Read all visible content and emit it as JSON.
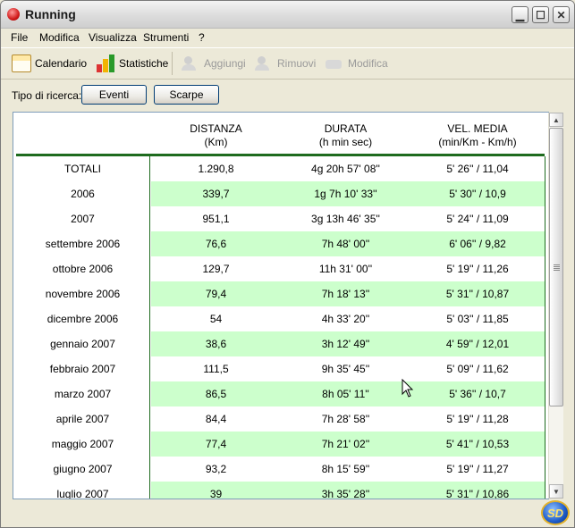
{
  "window": {
    "title": "Running"
  },
  "menu": [
    "File",
    "Modifica",
    "Visualizza",
    "Strumenti",
    "?"
  ],
  "toolbar": {
    "calendario": "Calendario",
    "statistiche": "Statistiche",
    "aggiungi": "Aggiungi",
    "rimuovi": "Rimuovi",
    "modifica": "Modifica"
  },
  "search": {
    "label": "Tipo di ricerca:",
    "eventi": "Eventi",
    "scarpe": "Scarpe"
  },
  "table": {
    "headers": [
      {
        "line1": "",
        "line2": ""
      },
      {
        "line1": "DISTANZA",
        "line2": "(Km)"
      },
      {
        "line1": "DURATA",
        "line2": "(h min sec)"
      },
      {
        "line1": "VEL. MEDIA",
        "line2": "(min/Km - Km/h)"
      }
    ],
    "rows": [
      [
        "TOTALI",
        "1.290,8",
        "4g 20h 57' 08''",
        "5' 26'' / 11,04"
      ],
      [
        "2006",
        "339,7",
        "1g 7h 10' 33''",
        "5' 30'' / 10,9"
      ],
      [
        "2007",
        "951,1",
        "3g 13h 46' 35''",
        "5' 24'' / 11,09"
      ],
      [
        "settembre 2006",
        "76,6",
        "7h 48' 00''",
        "6' 06'' / 9,82"
      ],
      [
        "ottobre 2006",
        "129,7",
        "11h 31' 00''",
        "5' 19'' / 11,26"
      ],
      [
        "novembre 2006",
        "79,4",
        "7h 18' 13''",
        "5' 31'' / 10,87"
      ],
      [
        "dicembre 2006",
        "54",
        "4h 33' 20''",
        "5' 03'' / 11,85"
      ],
      [
        "gennaio 2007",
        "38,6",
        "3h 12' 49''",
        "4' 59'' / 12,01"
      ],
      [
        "febbraio 2007",
        "111,5",
        "9h 35' 45''",
        "5' 09'' / 11,62"
      ],
      [
        "marzo 2007",
        "86,5",
        "8h 05' 11''",
        "5' 36'' / 10,7"
      ],
      [
        "aprile 2007",
        "84,4",
        "7h 28' 58''",
        "5' 19'' / 11,28"
      ],
      [
        "maggio 2007",
        "77,4",
        "7h 21' 02''",
        "5' 41'' / 10,53"
      ],
      [
        "giugno 2007",
        "93,2",
        "8h 15' 59''",
        "5' 19'' / 11,27"
      ],
      [
        "luglio 2007",
        "39",
        "3h 35' 28''",
        "5' 31'' / 10,86"
      ]
    ]
  },
  "badge": {
    "text": "SD"
  },
  "colors": {
    "row_alt": "#ccffcc",
    "rule": "#1e6b1e",
    "panel_border": "#7f9db9"
  }
}
